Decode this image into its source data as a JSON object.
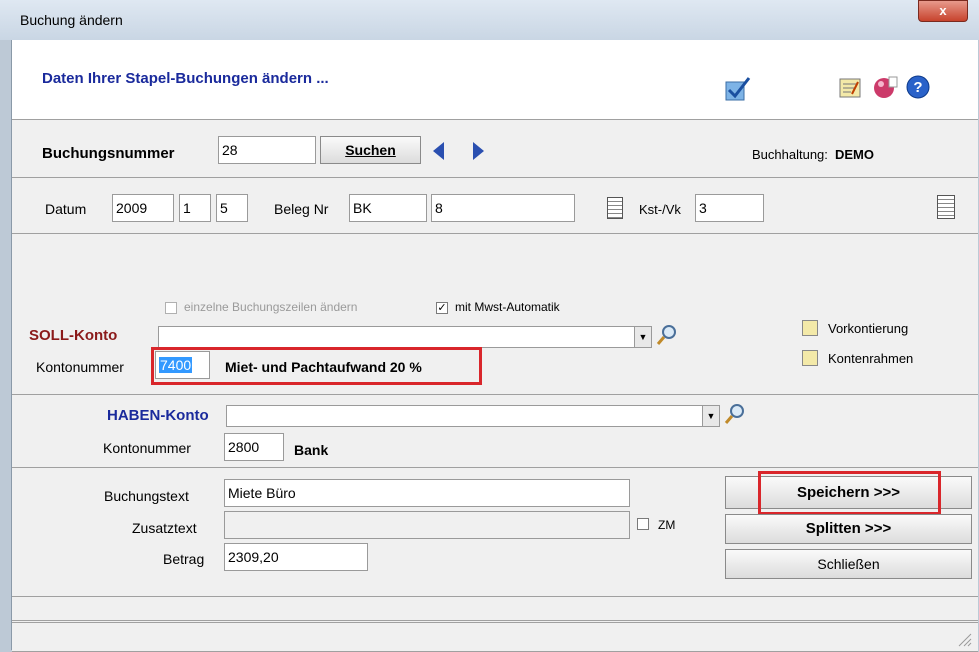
{
  "window": {
    "title": "Buchung ändern",
    "close_label": "x"
  },
  "header": {
    "title": "Daten Ihrer Stapel-Buchungen ändern ..."
  },
  "search": {
    "label": "Buchungsnummer",
    "value": "28",
    "search_button": "Suchen",
    "buchhaltung_label": "Buchhaltung:",
    "buchhaltung_value": "DEMO"
  },
  "date_row": {
    "datum_label": "Datum",
    "year": "2009",
    "month": "1",
    "day": "5",
    "beleg_label": "Beleg Nr",
    "beleg_prefix": "BK",
    "beleg_number": "8",
    "kst_label": "Kst-/Vk",
    "kst_value": "3"
  },
  "soll": {
    "single_lines_label": "einzelne Buchungszeilen ändern",
    "single_lines_checked": false,
    "mwst_label": "mit Mwst-Automatik",
    "mwst_checked": true,
    "heading": "SOLL-Konto",
    "combo_value": "",
    "kontonummer_label": "Kontonummer",
    "kontonummer": "7400",
    "konto_name": "Miet- und Pachtaufwand 20 %",
    "vorkontierung_label": "Vorkontierung",
    "kontenrahmen_label": "Kontenrahmen"
  },
  "haben": {
    "heading": "HABEN-Konto",
    "combo_value": "",
    "kontonummer_label": "Kontonummer",
    "kontonummer": "2800",
    "konto_name": "Bank"
  },
  "details": {
    "buchungstext_label": "Buchungstext",
    "buchungstext": "Miete Büro",
    "zusatztext_label": "Zusatztext",
    "zusatztext": "",
    "zm_label": "ZM",
    "zm_checked": false,
    "betrag_label": "Betrag",
    "betrag": "2309,20"
  },
  "actions": {
    "save": "Speichern >>>",
    "split": "Splitten >>>",
    "close": "Schließen"
  },
  "colors": {
    "accent_blue": "#1a2a9c",
    "soll_red": "#8b1a1a",
    "highlight_red": "#d9262b"
  }
}
